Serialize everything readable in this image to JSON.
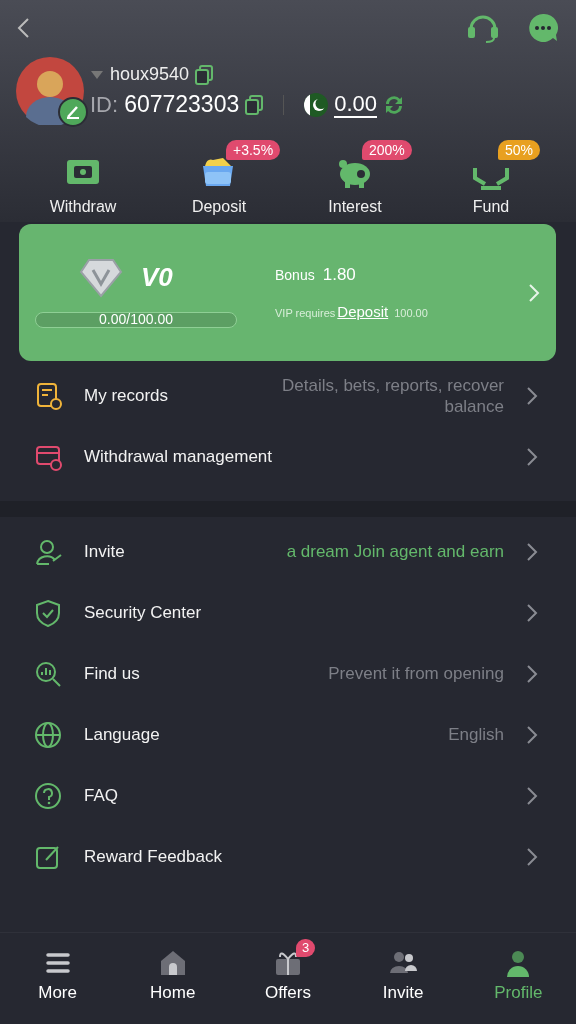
{
  "profile": {
    "username": "houx9540",
    "id_label": "ID:",
    "id": "607723303",
    "balance": "0.00"
  },
  "actions": [
    {
      "label": "Withdraw"
    },
    {
      "label": "Deposit",
      "badge": "+3.5%",
      "color": "#e04a6e"
    },
    {
      "label": "Interest",
      "badge": "200%",
      "color": "#e04a6e"
    },
    {
      "label": "Fund",
      "badge": "50%",
      "color": "#e8a020"
    }
  ],
  "vip": {
    "level_name": "V0",
    "progress": "0.00/100.00",
    "level": 0,
    "bonus_label": "Bonus",
    "bonus": "1.80",
    "requires": "VIP requires",
    "requires_link": "Deposit",
    "requires_amount": "100.00"
  },
  "menu_groups": [
    [
      {
        "label": "My records",
        "hint": "Details, bets, reports, recover balance",
        "highlight": false
      },
      {
        "label": "Withdrawal management"
      }
    ],
    [
      {
        "label": "Invite",
        "hint": "a dream  Join agent and earn",
        "highlight": true
      },
      {
        "label": "Security Center"
      },
      {
        "label": "Find us",
        "hint": "Prevent it from opening",
        "highlight": false
      },
      {
        "label": "Language",
        "hint": "English",
        "highlight": false
      },
      {
        "label": "FAQ"
      },
      {
        "label": "Reward Feedback"
      }
    ]
  ],
  "nav": [
    {
      "label": "More",
      "selected": false
    },
    {
      "label": "Home",
      "selected": false
    },
    {
      "label": "Offers",
      "selected": false,
      "badge": "3"
    },
    {
      "label": "Invite",
      "selected": false
    },
    {
      "label": "Profile",
      "selected": true
    }
  ]
}
